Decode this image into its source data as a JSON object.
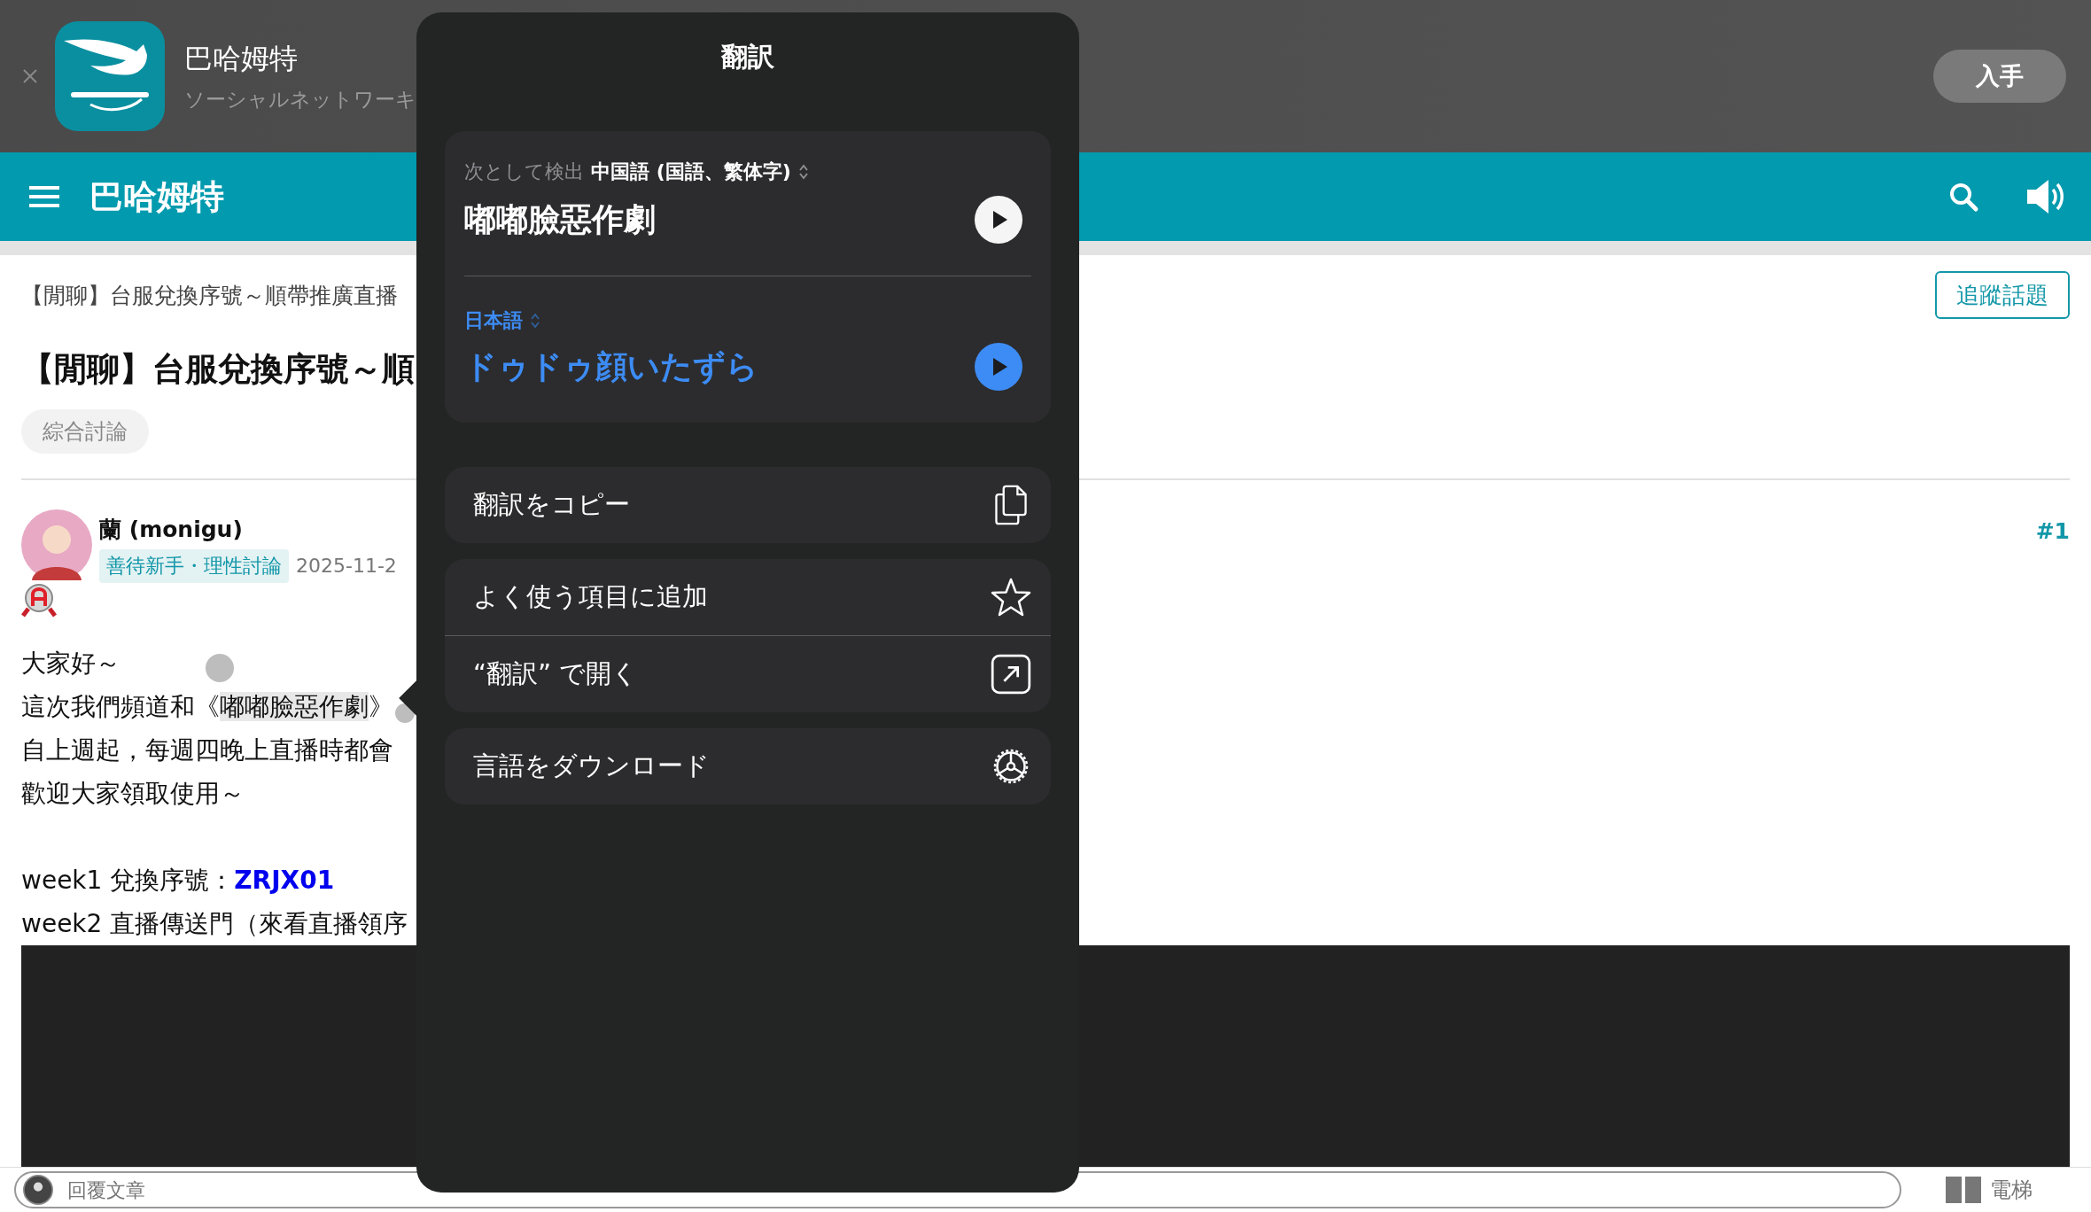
{
  "app_banner": {
    "title": "巴哈姆特",
    "subtitle": "ソーシャルネットワーキ",
    "get_button": "入手"
  },
  "navbar": {
    "title": "巴哈姆特"
  },
  "thread": {
    "breadcrumb": "【閒聊】台服兌換序號～順帶推廣直播",
    "follow_button": "追蹤話題",
    "title": "【閒聊】台服兌換序號～順",
    "tag": "綜合討論"
  },
  "post": {
    "author": "蘭 (monigu)",
    "badge": "善待新手・理性討論",
    "date": "2025-11-2",
    "floor": "#1",
    "body": [
      {
        "kind": "text",
        "text": "大家好～"
      },
      {
        "kind": "selection",
        "before": "這次我們頻道和《",
        "selected": "嘟嘟臉惡作劇",
        "after": "》"
      },
      {
        "kind": "text",
        "text": "自上週起，每週四晚上直播時都會"
      },
      {
        "kind": "text",
        "text": "歡迎大家領取使用～"
      },
      {
        "kind": "spacer"
      },
      {
        "kind": "text",
        "text": "week1 兌換序號：**ZRJX01**"
      },
      {
        "kind": "text",
        "text": "week2 直播傳送門（來看直播領序"
      }
    ]
  },
  "reply_bar": {
    "placeholder": "回覆文章",
    "elevator": "電梯"
  },
  "translate_popup": {
    "title": "翻訳",
    "source": {
      "detected_label": "次として検出",
      "language": "中国語 (国語、繁体字)",
      "text": "嘟嘟臉惡作劇"
    },
    "target": {
      "language": "日本語",
      "text": "ドゥドゥ顔いたずら"
    },
    "action_groups": [
      [
        {
          "kind": "copy",
          "label": "翻訳をコピー"
        }
      ],
      [
        {
          "kind": "favorite",
          "label": "よく使う項目に追加"
        },
        {
          "kind": "open",
          "label": "“翻訳” で開く"
        }
      ],
      [
        {
          "kind": "download",
          "label": "言語をダウンロード"
        }
      ]
    ]
  }
}
